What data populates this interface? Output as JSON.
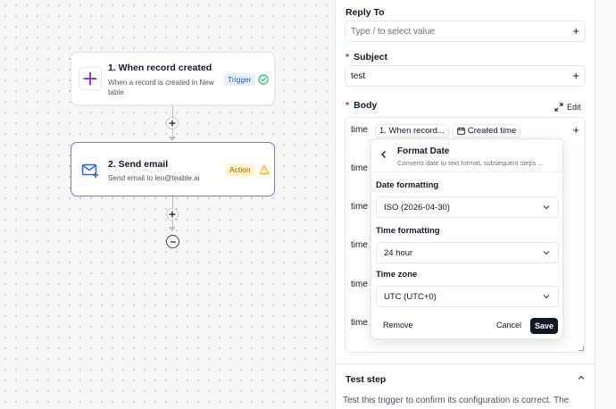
{
  "workflow": {
    "trigger": {
      "title": "1. When record created",
      "description": "When a record is created in New table",
      "badge": "Trigger",
      "icon": "plus-icon",
      "status_icon": "check-circle-icon"
    },
    "action": {
      "title": "2. Send email",
      "description": "Send email to leo@teable.ai",
      "badge": "Action",
      "icon": "mail-plus-icon",
      "status_icon": "warning-triangle-icon"
    }
  },
  "panel": {
    "reply_to": {
      "label": "Reply To",
      "placeholder": "Type / to select value"
    },
    "subject": {
      "label": "Subject",
      "value": "test",
      "required_mark": "*"
    },
    "body": {
      "label": "Body",
      "required_mark": "*",
      "edit_label": "Edit",
      "lines": [
        "time",
        "time",
        "time",
        "time",
        "time",
        "time"
      ],
      "chip_record": "1. When record...",
      "chip_field": "Created time"
    },
    "test_step": {
      "title": "Test step",
      "description": "Test this trigger to confirm its configuration is correct. The"
    }
  },
  "popover": {
    "title": "Format Date",
    "subtitle": "Converts date to text format, subsequent steps ...",
    "date_formatting": {
      "label": "Date formatting",
      "value": "ISO (2026-04-30)"
    },
    "time_formatting": {
      "label": "Time formatting",
      "value": "24 hour"
    },
    "time_zone": {
      "label": "Time zone",
      "value": "UTC (UTC+0)"
    },
    "remove_label": "Remove",
    "cancel_label": "Cancel",
    "save_label": "Save"
  },
  "colors": {
    "accent_blue": "#4f86f7",
    "trigger_badge_bg": "#e6efff",
    "action_badge_bg": "#fff4c7",
    "success_green": "#22c55e",
    "warning_yellow": "#eab308",
    "required_red": "#e11d48",
    "trigger_icon_purple": "#9333ea"
  }
}
